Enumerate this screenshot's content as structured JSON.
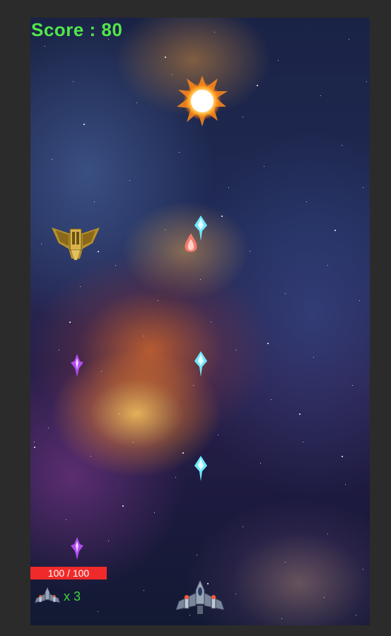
{
  "hud": {
    "score_text": "Score : 80",
    "health_text": "100 / 100",
    "health_fraction": 1.0,
    "lives_text": "x 3"
  },
  "colors": {
    "score": "#52e64a",
    "health_bar": "#f02a2a",
    "lives_text": "#3ed63e",
    "window_border": "#2b2b2b"
  },
  "sprites": [
    "explosion-icon",
    "enemy-ship-icon",
    "cyan-bullet-icon",
    "enemy-fire-bullet-icon",
    "purple-bullet-icon",
    "player-ship-icon",
    "lives-ship-icon"
  ]
}
